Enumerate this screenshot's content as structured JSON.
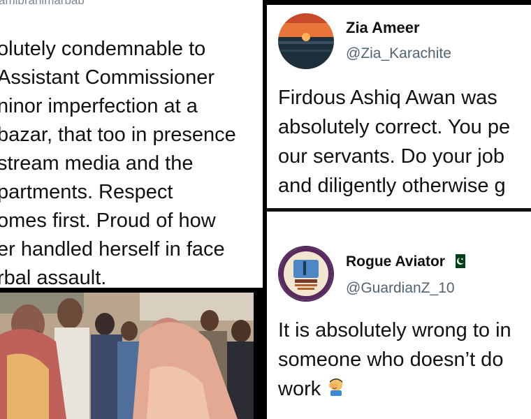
{
  "left_tweet": {
    "handle_fragment": "amibrahimarbab",
    "lines": [
      "olutely condemnable to",
      "Assistant Commissioner",
      "ninor imperfection at a",
      "bazar, that too in presence",
      "stream media and the",
      "partments. Respect",
      "omes first. Proud of how",
      "er handled herself in face",
      "rbal assault."
    ]
  },
  "tweet_zia": {
    "name": "Zia Ameer",
    "handle": "@Zia_Karachite",
    "lines": [
      "Firdous Ashiq Awan was",
      "absolutely correct. You pe",
      "our servants. Do your job",
      "and diligently otherwise g"
    ]
  },
  "tweet_rogue": {
    "name": "Rogue Aviator",
    "flag_icon": "pakistan-flag-icon",
    "handle": "@GuardianZ_10",
    "lines": [
      "It is absolutely wrong to in",
      "someone who doesn’t do",
      "work"
    ],
    "emoji_icon": "facepalm-emoji-icon"
  },
  "colors": {
    "handle_gray": "#536471",
    "flag_green": "#01411c"
  }
}
